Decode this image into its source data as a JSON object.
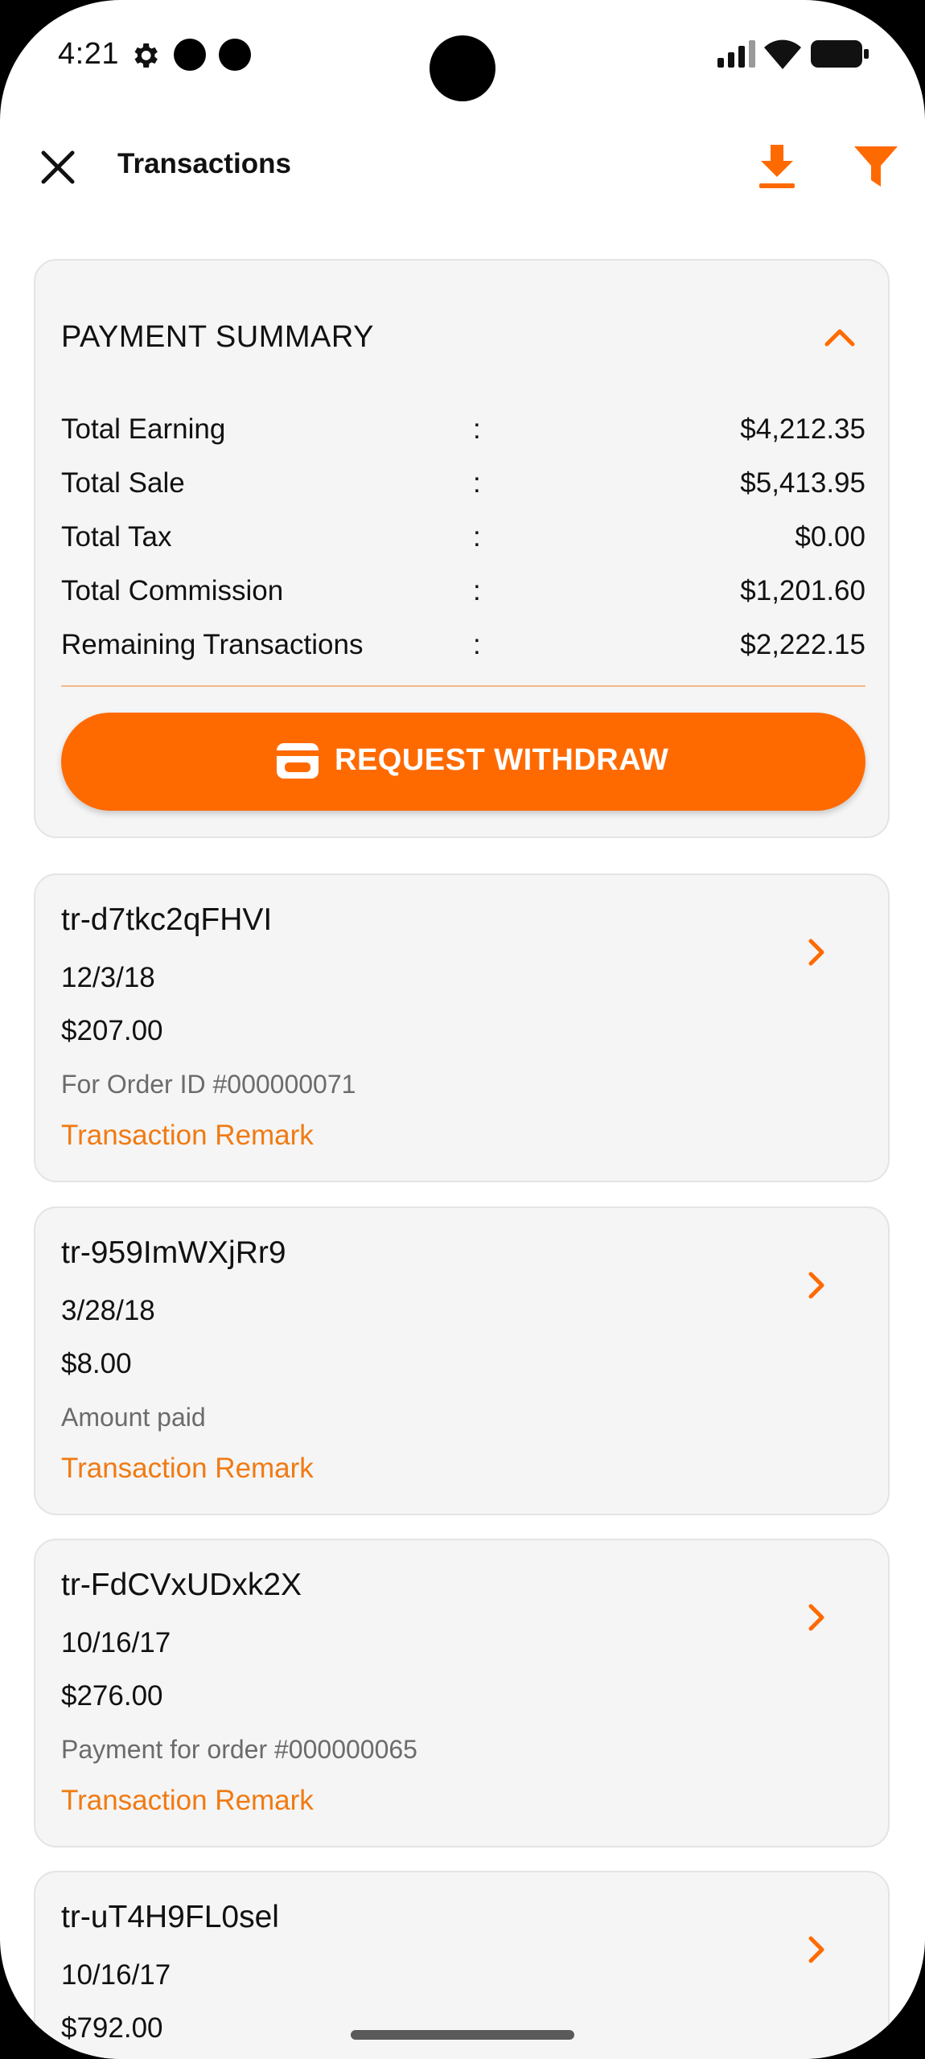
{
  "status_bar": {
    "time": "4:21",
    "icons": [
      "gear-icon",
      "notification-dot",
      "notification-dot",
      "signal-icon",
      "wifi-icon",
      "battery-icon"
    ]
  },
  "app_bar": {
    "title": "Transactions",
    "icons": [
      "close-icon",
      "download-icon",
      "filter-icon"
    ]
  },
  "colors": {
    "accent": "#ff6a00",
    "remark": "#f07a12",
    "card_bg": "#f5f5f5"
  },
  "summary": {
    "title": "PAYMENT SUMMARY",
    "colon": ":",
    "rows": [
      {
        "label": "Total Earning",
        "value": "$4,212.35"
      },
      {
        "label": "Total Sale",
        "value": "$5,413.95"
      },
      {
        "label": "Total Tax",
        "value": "$0.00"
      },
      {
        "label": "Total Commission",
        "value": "$1,201.60"
      },
      {
        "label": "Remaining Transactions",
        "value": "$2,222.15"
      }
    ],
    "withdraw_label": "REQUEST WITHDRAW"
  },
  "transactions": [
    {
      "id": "tr-d7tkc2qFHVI",
      "date": "12/3/18",
      "amount": "$207.00",
      "description": "For Order ID #000000071",
      "remark": "Transaction Remark"
    },
    {
      "id": "tr-959ImWXjRr9",
      "date": "3/28/18",
      "amount": "$8.00",
      "description": "Amount paid",
      "remark": "Transaction Remark"
    },
    {
      "id": "tr-FdCVxUDxk2X",
      "date": "10/16/17",
      "amount": "$276.00",
      "description": "Payment for order #000000065",
      "remark": "Transaction Remark"
    },
    {
      "id": "tr-uT4H9FL0sel",
      "date": "10/16/17",
      "amount": "$792.00",
      "description": "",
      "remark": ""
    }
  ]
}
